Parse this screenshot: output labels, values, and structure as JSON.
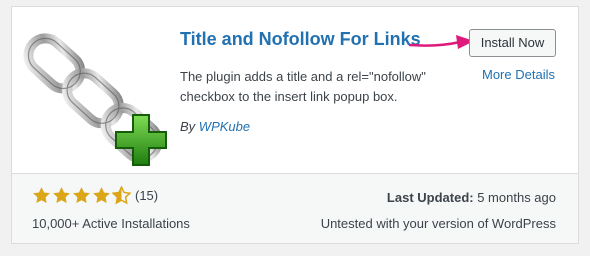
{
  "plugin": {
    "title": "Title and Nofollow For Links",
    "description": "The plugin adds a title and a rel=\"nofollow\" checkbox to the insert link popup box.",
    "author_prefix": "By",
    "author_name": "WPKube",
    "icon": "chain-link-plus-icon"
  },
  "actions": {
    "install_label": "Install Now",
    "more_details_label": "More Details"
  },
  "footer": {
    "rating": 4.5,
    "rating_max": 5,
    "rating_count": "(15)",
    "installs": "10,000+ Active Installations",
    "last_updated_label": "Last Updated:",
    "last_updated_value": "5 months ago",
    "compatibility": "Untested with your version of WordPress"
  },
  "colors": {
    "link": "#2271b1",
    "star": "#dba617",
    "arrow": "#e0197d",
    "plus": "#2e9a1a"
  }
}
